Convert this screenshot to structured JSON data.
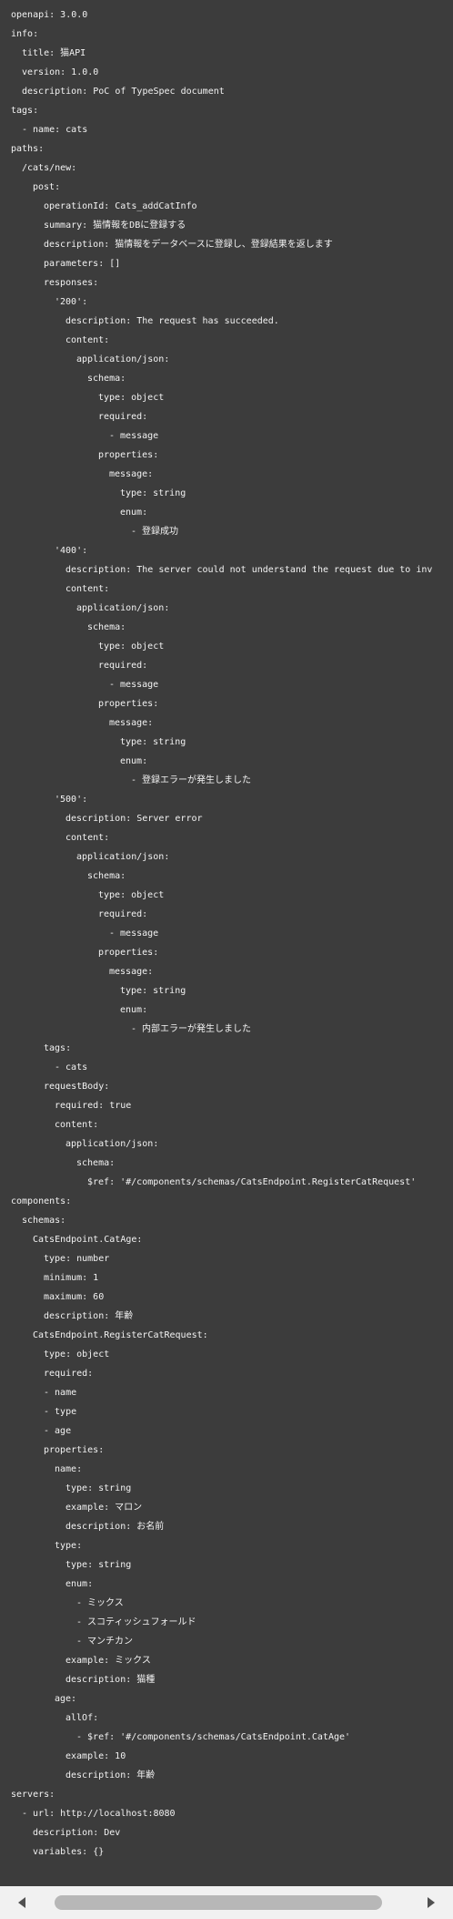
{
  "yaml_lines": [
    {
      "indent": 0,
      "text": "openapi: 3.0.0"
    },
    {
      "indent": 0,
      "text": "info:"
    },
    {
      "indent": 1,
      "text": "title: 猫API"
    },
    {
      "indent": 1,
      "text": "version: 1.0.0"
    },
    {
      "indent": 1,
      "text": "description: PoC of TypeSpec document"
    },
    {
      "indent": 0,
      "text": "tags:"
    },
    {
      "indent": 1,
      "text": "- name: cats"
    },
    {
      "indent": 0,
      "text": "paths:"
    },
    {
      "indent": 1,
      "text": "/cats/new:"
    },
    {
      "indent": 2,
      "text": "post:"
    },
    {
      "indent": 3,
      "text": "operationId: Cats_addCatInfo"
    },
    {
      "indent": 3,
      "text": "summary: 猫情報をDBに登録する"
    },
    {
      "indent": 3,
      "text": "description: 猫情報をデータベースに登録し、登録結果を返します"
    },
    {
      "indent": 3,
      "text": "parameters: []"
    },
    {
      "indent": 3,
      "text": "responses:"
    },
    {
      "indent": 4,
      "text": "'200':"
    },
    {
      "indent": 5,
      "text": "description: The request has succeeded."
    },
    {
      "indent": 5,
      "text": "content:"
    },
    {
      "indent": 6,
      "text": "application/json:"
    },
    {
      "indent": 7,
      "text": "schema:"
    },
    {
      "indent": 8,
      "text": "type: object"
    },
    {
      "indent": 8,
      "text": "required:"
    },
    {
      "indent": 9,
      "text": "- message"
    },
    {
      "indent": 8,
      "text": "properties:"
    },
    {
      "indent": 9,
      "text": "message:"
    },
    {
      "indent": 10,
      "text": "type: string"
    },
    {
      "indent": 10,
      "text": "enum:"
    },
    {
      "indent": 11,
      "text": "- 登録成功"
    },
    {
      "indent": 4,
      "text": "'400':"
    },
    {
      "indent": 5,
      "text": "description: The server could not understand the request due to inv"
    },
    {
      "indent": 5,
      "text": "content:"
    },
    {
      "indent": 6,
      "text": "application/json:"
    },
    {
      "indent": 7,
      "text": "schema:"
    },
    {
      "indent": 8,
      "text": "type: object"
    },
    {
      "indent": 8,
      "text": "required:"
    },
    {
      "indent": 9,
      "text": "- message"
    },
    {
      "indent": 8,
      "text": "properties:"
    },
    {
      "indent": 9,
      "text": "message:"
    },
    {
      "indent": 10,
      "text": "type: string"
    },
    {
      "indent": 10,
      "text": "enum:"
    },
    {
      "indent": 11,
      "text": "- 登録エラーが発生しました"
    },
    {
      "indent": 4,
      "text": "'500':"
    },
    {
      "indent": 5,
      "text": "description: Server error"
    },
    {
      "indent": 5,
      "text": "content:"
    },
    {
      "indent": 6,
      "text": "application/json:"
    },
    {
      "indent": 7,
      "text": "schema:"
    },
    {
      "indent": 8,
      "text": "type: object"
    },
    {
      "indent": 8,
      "text": "required:"
    },
    {
      "indent": 9,
      "text": "- message"
    },
    {
      "indent": 8,
      "text": "properties:"
    },
    {
      "indent": 9,
      "text": "message:"
    },
    {
      "indent": 10,
      "text": "type: string"
    },
    {
      "indent": 10,
      "text": "enum:"
    },
    {
      "indent": 11,
      "text": "- 内部エラーが発生しました"
    },
    {
      "indent": 3,
      "text": "tags:"
    },
    {
      "indent": 4,
      "text": "- cats"
    },
    {
      "indent": 3,
      "text": "requestBody:"
    },
    {
      "indent": 4,
      "text": "required: true"
    },
    {
      "indent": 4,
      "text": "content:"
    },
    {
      "indent": 5,
      "text": "application/json:"
    },
    {
      "indent": 6,
      "text": "schema:"
    },
    {
      "indent": 7,
      "text": "$ref: '#/components/schemas/CatsEndpoint.RegisterCatRequest'"
    },
    {
      "indent": 0,
      "text": "components:"
    },
    {
      "indent": 1,
      "text": "schemas:"
    },
    {
      "indent": 2,
      "text": "CatsEndpoint.CatAge:"
    },
    {
      "indent": 3,
      "text": "type: number"
    },
    {
      "indent": 3,
      "text": "minimum: 1"
    },
    {
      "indent": 3,
      "text": "maximum: 60"
    },
    {
      "indent": 3,
      "text": "description: 年齢"
    },
    {
      "indent": 2,
      "text": "CatsEndpoint.RegisterCatRequest:"
    },
    {
      "indent": 3,
      "text": "type: object"
    },
    {
      "indent": 3,
      "text": "required:"
    },
    {
      "indent": 3,
      "text": "- name"
    },
    {
      "indent": 3,
      "text": "- type"
    },
    {
      "indent": 3,
      "text": "- age"
    },
    {
      "indent": 3,
      "text": "properties:"
    },
    {
      "indent": 4,
      "text": "name:"
    },
    {
      "indent": 5,
      "text": "type: string"
    },
    {
      "indent": 5,
      "text": "example: マロン"
    },
    {
      "indent": 5,
      "text": "description: お名前"
    },
    {
      "indent": 4,
      "text": "type:"
    },
    {
      "indent": 5,
      "text": "type: string"
    },
    {
      "indent": 5,
      "text": "enum:"
    },
    {
      "indent": 6,
      "text": "- ミックス"
    },
    {
      "indent": 6,
      "text": "- スコティッシュフォールド"
    },
    {
      "indent": 6,
      "text": "- マンチカン"
    },
    {
      "indent": 5,
      "text": "example: ミックス"
    },
    {
      "indent": 5,
      "text": "description: 猫種"
    },
    {
      "indent": 4,
      "text": "age:"
    },
    {
      "indent": 5,
      "text": "allOf:"
    },
    {
      "indent": 6,
      "text": "- $ref: '#/components/schemas/CatsEndpoint.CatAge'"
    },
    {
      "indent": 5,
      "text": "example: 10"
    },
    {
      "indent": 5,
      "text": "description: 年齢"
    },
    {
      "indent": 0,
      "text": "servers:"
    },
    {
      "indent": 1,
      "text": "- url: http://localhost:8080"
    },
    {
      "indent": 2,
      "text": "description: Dev"
    },
    {
      "indent": 2,
      "text": "variables: {}"
    }
  ],
  "scrollbar": {
    "left_arrow_icon": "triangle-left",
    "right_arrow_icon": "triangle-right"
  }
}
